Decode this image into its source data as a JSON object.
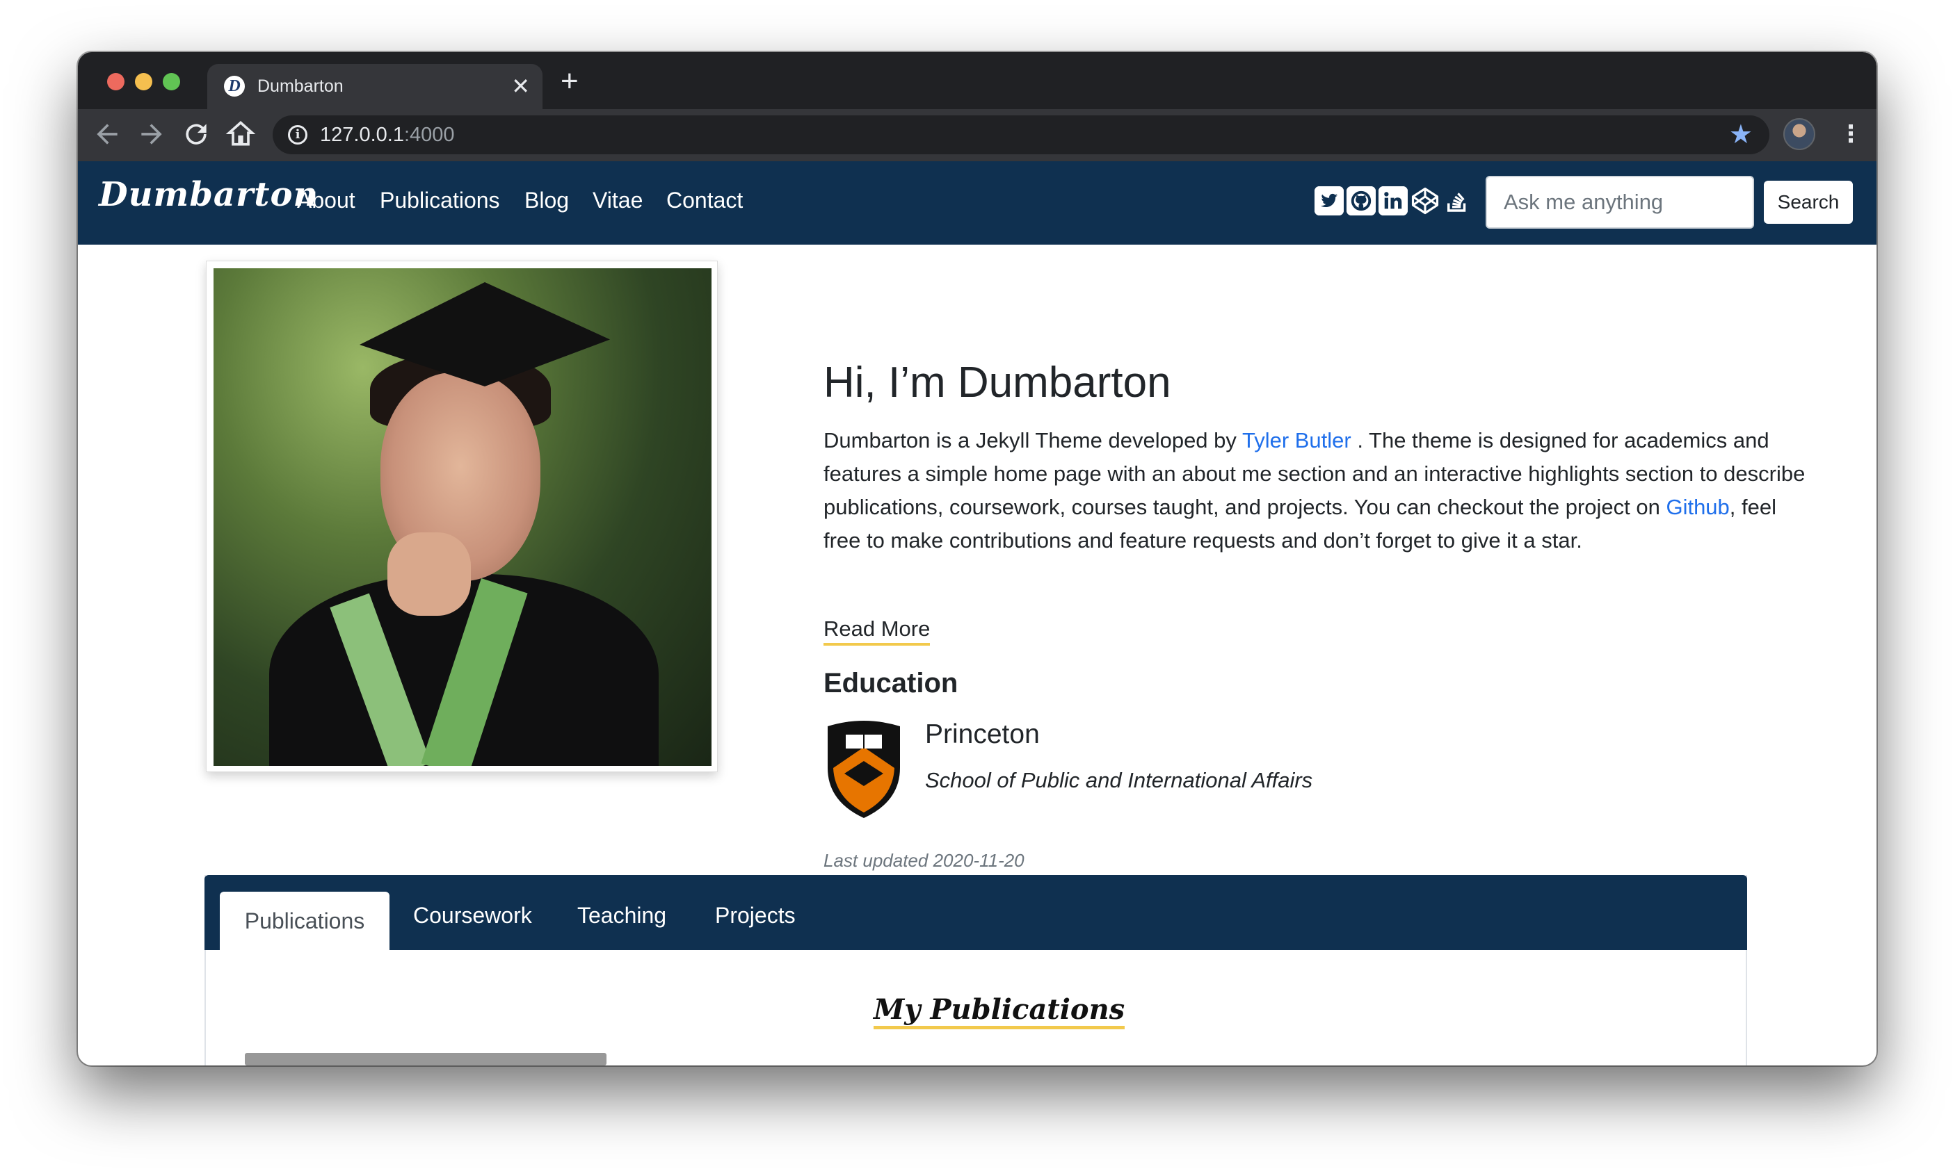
{
  "browser": {
    "tab_title": "Dumbarton",
    "tab_favicon": "D",
    "close_glyph": "✕",
    "new_tab_glyph": "+",
    "url_host": "127.0.0.1",
    "url_port": ":4000"
  },
  "site": {
    "brand": "Dumbarton",
    "nav": [
      "About",
      "Publications",
      "Blog",
      "Vitae",
      "Contact"
    ],
    "social_icons": [
      "twitter-icon",
      "github-icon",
      "linkedin-icon",
      "codepen-icon",
      "stackoverflow-icon"
    ],
    "search_placeholder": "Ask me anything",
    "search_button": "Search"
  },
  "hero": {
    "title": "Hi, I’m Dumbarton",
    "bio_pre": "Dumbarton is a Jekyll Theme developed by ",
    "bio_link1": "Tyler Butler",
    "bio_mid": " . The theme is designed for academics and features a simple home page with an about me section and an interactive highlights section to describe publications, coursework, courses taught, and projects. You can checkout the project on ",
    "bio_link2": "Github",
    "bio_post": ", feel free to make contributions and feature requests and don’t forget to give it a star.",
    "read_more": "Read More"
  },
  "education": {
    "heading": "Education",
    "school": "Princeton",
    "department": "School of Public and International Affairs"
  },
  "updated": "Last updated 2020-11-20",
  "tabs": {
    "items": [
      "Publications",
      "Coursework",
      "Teaching",
      "Projects"
    ],
    "active": "Publications",
    "section_heading": "My Publications"
  },
  "colors": {
    "navbar": "#0f3050",
    "link": "#1f6feb",
    "underline_accent": "#f2c94c"
  }
}
